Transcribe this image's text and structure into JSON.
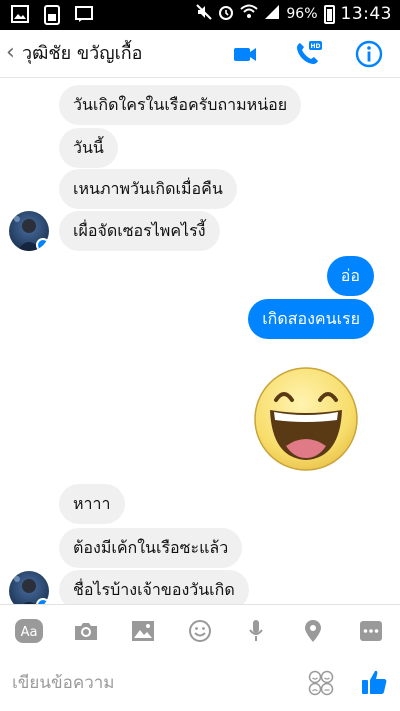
{
  "status_bar": {
    "battery": "96%",
    "time": "13:43"
  },
  "header": {
    "back_glyph": "‹",
    "contact_name": "วุฒิชัย ขวัญเกื้อ"
  },
  "messages": [
    {
      "side": "in",
      "text": "วันเกิดใครในเรือครับถามหน่อย"
    },
    {
      "side": "in",
      "text": "วันนี้"
    },
    {
      "side": "in",
      "text": "เหนภาพวันเกิดเมื่อคืน"
    },
    {
      "side": "in",
      "text": "เผื่อจัดเซอรไพคไรงี้"
    },
    {
      "side": "out",
      "text": "อ่อ"
    },
    {
      "side": "out",
      "text": "เกิดสองคนเรย"
    },
    {
      "side": "out",
      "sticker": "laughing-face-sticker"
    },
    {
      "side": "in",
      "text": "หาาา"
    },
    {
      "side": "in",
      "text": "ต้องมีเค้กในเรือซะแล้ว"
    },
    {
      "side": "in",
      "text": "ชื่อไรบ้างเจ้าของวันเกิด"
    }
  ],
  "composer": {
    "placeholder": "เขียนข้อความ",
    "aa_label": "Aa"
  },
  "colors": {
    "accent": "#0084ff",
    "incoming_bubble": "#f1f0f0",
    "icon_gray": "#9a9a9a"
  }
}
